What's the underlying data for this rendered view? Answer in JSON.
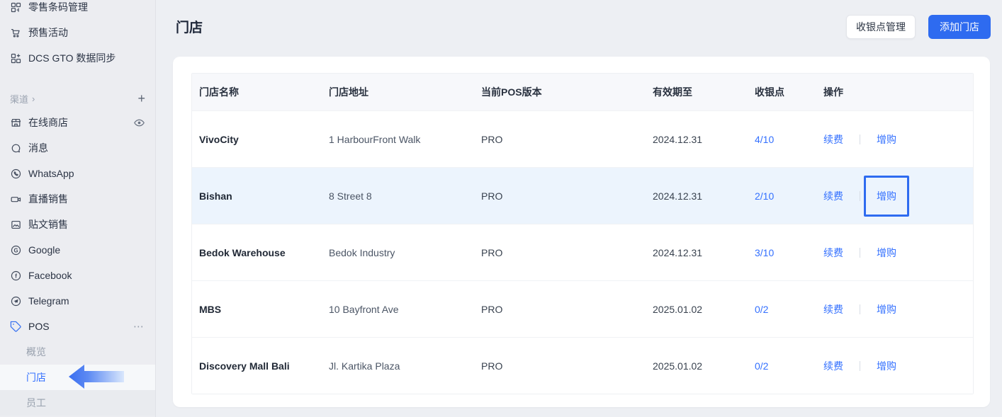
{
  "colors": {
    "accent": "#2e6bf0",
    "link_blue": "#3370ff",
    "highlight_row": "#ecf4fd",
    "sidebar_bg": "#ecedf1"
  },
  "sidebar": {
    "top_items": [
      {
        "label": "零售条码管理",
        "icon": "barcode-grid-icon"
      },
      {
        "label": "预售活动",
        "icon": "presale-cart-icon"
      },
      {
        "label": "DCS GTO 数据同步",
        "icon": "grid-plus-icon"
      }
    ],
    "section": {
      "label": "渠道",
      "chevron": "›",
      "add_label": "+"
    },
    "channel_items": [
      {
        "label": "在线商店",
        "icon": "storefront-icon",
        "trailing": "eye-icon"
      },
      {
        "label": "消息",
        "icon": "chat-icon"
      },
      {
        "label": "WhatsApp",
        "icon": "whatsapp-icon"
      },
      {
        "label": "直播销售",
        "icon": "video-camera-icon"
      },
      {
        "label": "贴文销售",
        "icon": "image-icon"
      },
      {
        "label": "Google",
        "icon": "google-icon"
      },
      {
        "label": "Facebook",
        "icon": "facebook-icon"
      },
      {
        "label": "Telegram",
        "icon": "telegram-icon"
      },
      {
        "label": "POS",
        "icon": "tag-icon",
        "trailing": "ellipsis-icon",
        "trailing_glyph": "⋯",
        "active": true
      }
    ],
    "pos_subitems": [
      {
        "label": "概览"
      },
      {
        "label": "门店",
        "active": true,
        "annotation": "blue-arrow-callout"
      },
      {
        "label": "员工"
      }
    ]
  },
  "header": {
    "title": "门店",
    "secondary_button": "收银点管理",
    "primary_button": "添加门店"
  },
  "table": {
    "columns": [
      "门店名称",
      "门店地址",
      "当前POS版本",
      "有效期至",
      "收银点",
      "操作"
    ],
    "action_labels": {
      "renew": "续费",
      "addon": "增购"
    },
    "rows": [
      {
        "name": "VivoCity",
        "address": "1 HarbourFront Walk",
        "version": "PRO",
        "expiry": "2024.12.31",
        "cashiers": "4/10"
      },
      {
        "name": "Bishan",
        "address": "8 Street 8",
        "version": "PRO",
        "expiry": "2024.12.31",
        "cashiers": "2/10",
        "highlighted": true,
        "boxed_action": "增购"
      },
      {
        "name": "Bedok Warehouse",
        "address": "Bedok Industry",
        "version": "PRO",
        "expiry": "2024.12.31",
        "cashiers": "3/10"
      },
      {
        "name": "MBS",
        "address": "10 Bayfront Ave",
        "version": "PRO",
        "expiry": "2025.01.02",
        "cashiers": "0/2"
      },
      {
        "name": "Discovery Mall Bali",
        "address": "Jl. Kartika Plaza",
        "version": "PRO",
        "expiry": "2025.01.02",
        "cashiers": "0/2"
      }
    ]
  }
}
